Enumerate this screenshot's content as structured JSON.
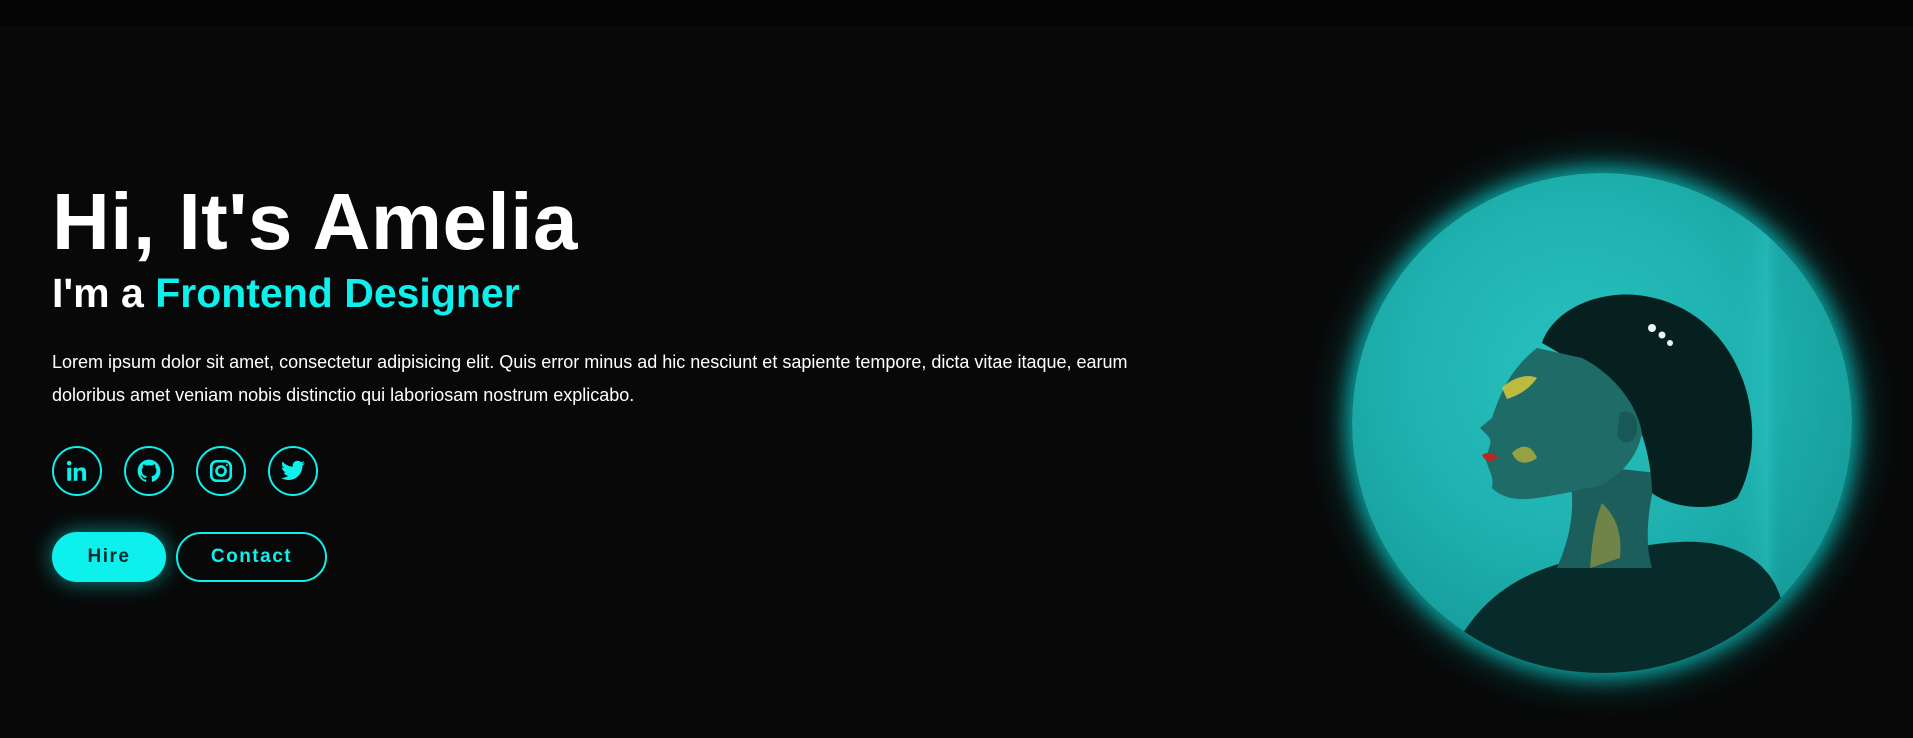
{
  "hero": {
    "greeting": "Hi, It's Amelia",
    "role_prefix": "I'm a ",
    "role": "Frontend Designer",
    "description": "Lorem ipsum dolor sit amet, consectetur adipisicing elit. Quis error minus ad hic nesciunt et sapiente tempore, dicta vitae itaque, earum doloribus amet veniam nobis distinctio qui laboriosam nostrum explicabo."
  },
  "socials": [
    {
      "icon": "linkedin-icon"
    },
    {
      "icon": "github-icon"
    },
    {
      "icon": "instagram-icon"
    },
    {
      "icon": "twitter-icon"
    }
  ],
  "buttons": {
    "hire": "Hire",
    "contact": "Contact"
  },
  "colors": {
    "accent": "#0ef0ec",
    "background": "#080808",
    "text": "#ffffff"
  }
}
